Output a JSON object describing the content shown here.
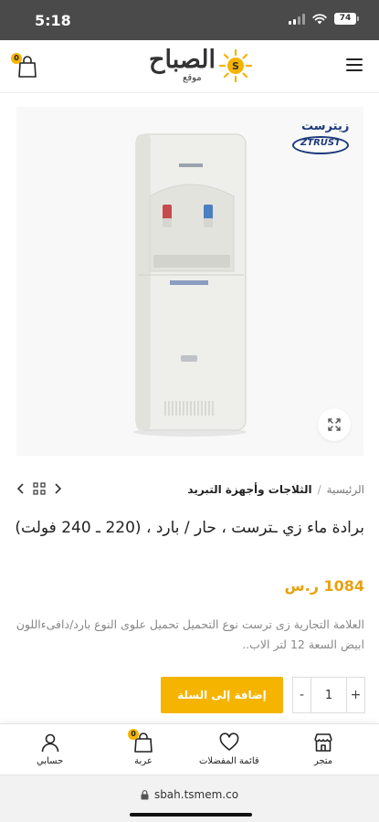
{
  "status_bar": {
    "time": "5:18",
    "battery": "74"
  },
  "header": {
    "logo_title": "الصباح",
    "logo_subtitle": "موقع",
    "logo_badge": "S",
    "cart_count": "0"
  },
  "gallery": {
    "brand_arabic": "زيترست",
    "brand_latin": "ZTRUST"
  },
  "breadcrumb": {
    "home": "الرئيسية",
    "separator": "/",
    "category": "الثلاجات وأجهزة التبريد"
  },
  "product": {
    "title": "برادة ماء زي ـترست ، حار / بارد ، (220 ـ 240 فولت)",
    "price": "1084 ر.س",
    "description": "العلامة التجارية  زى ترست    نوع التحميل  تحميل علوى    النوع  بارد/دافىءاللون  ابيض   السعة   12 لتر الاب.."
  },
  "purchase": {
    "quantity": "1",
    "plus": "+",
    "minus": "-",
    "add_to_cart_label": "إضافة إلى السلة"
  },
  "bottom_nav": {
    "items": [
      {
        "label": "متجر",
        "icon": "store-icon"
      },
      {
        "label": "قائمة المفضلات",
        "icon": "heart-icon"
      },
      {
        "label": "عربة",
        "icon": "bag-icon",
        "badge": "0"
      },
      {
        "label": "حسابي",
        "icon": "user-icon"
      }
    ]
  },
  "browser": {
    "url": "sbah.tsmem.co"
  },
  "colors": {
    "accent": "#f5b400",
    "price": "#e8a20c",
    "status_bar": "#4a4a4a",
    "brand_blue": "#1d3a7a"
  }
}
